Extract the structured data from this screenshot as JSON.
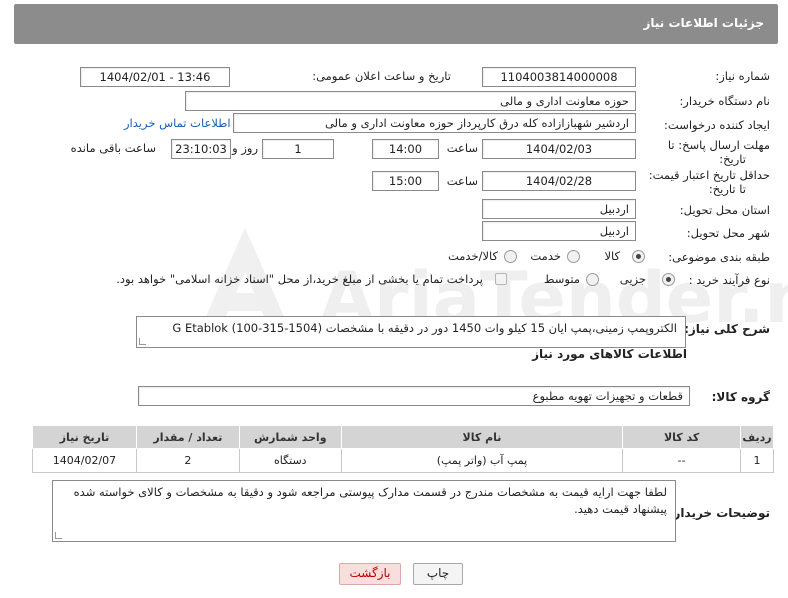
{
  "header": {
    "title": "جزئیات اطلاعات نیاز"
  },
  "fields": {
    "need_number_label": "شماره نیاز:",
    "need_number": "1104003814000008",
    "announce_label": "تاریخ و ساعت اعلان عمومی:",
    "announce_value": "1404/02/01 - 13:46",
    "buyer_label": "نام دستگاه خریدار:",
    "buyer_value": "حوزه معاونت اداری و مالی",
    "creator_label": "ایجاد کننده درخواست:",
    "creator_value": "اردشیر شهبازازاده کله درق کارپرداز حوزه معاونت اداری و مالی",
    "contact_link": "اطلاعات تماس خریدار",
    "deadline_label_1": "مهلت ارسال پاسخ: تا",
    "deadline_label_2": "تاریخ:",
    "deadline_date": "1404/02/03",
    "time_label": "ساعت",
    "deadline_time": "14:00",
    "days_value": "1",
    "days_label": "روز و",
    "remaining_value": "23:10:03",
    "remaining_label": "ساعت باقی مانده",
    "validity_label_1": "حداقل تاریخ اعتبار قیمت:",
    "validity_label_2": "تا تاریخ:",
    "validity_date": "1404/02/28",
    "validity_time_label": "ساعت",
    "validity_time": "15:00",
    "province_label": "استان محل تحویل:",
    "province_value": "اردبیل",
    "city_label": "شهر محل تحویل:",
    "city_value": "اردبیل",
    "category_label": "طبقه بندی موضوعی:",
    "category_options": [
      "کالا",
      "خدمت",
      "کالا/خدمت"
    ],
    "category_selected": "کالا",
    "process_label": "نوع فرآیند خرید :",
    "process_options": [
      "جزیی",
      "متوسط"
    ],
    "process_selected": "جزیی",
    "payment_note": "پرداخت تمام یا بخشی از مبلغ خرید،از محل \"اسناد خزانه اسلامی\" خواهد بود."
  },
  "description": {
    "label": "شرح کلی نیاز:",
    "value": "الکتروپمپ زمینی،پمپ ایان 15 کیلو وات 1450 دور در دقیقه با مشخصات (1504-315-100) G Etablok"
  },
  "goods_info_title": "اطلاعات کالاهای مورد نیاز",
  "goods_group": {
    "label": "گروه کالا:",
    "value": "قطعات و تجهیزات تهویه مطبوع"
  },
  "table": {
    "headers": [
      "ردیف",
      "کد کالا",
      "نام کالا",
      "واحد شمارش",
      "تعداد / مقدار",
      "تاریخ نیاز"
    ],
    "rows": [
      [
        "1",
        "--",
        "پمپ آب (واتر پمپ)",
        "دستگاه",
        "2",
        "1404/02/07"
      ]
    ]
  },
  "buyer_notes": {
    "label": "توضیحات خریدار:",
    "value": "لطفا جهت ارایه قیمت به مشخصات مندرج در قسمت مدارک پیوستی مراجعه شود و دقیقا به مشخصات و کالای خواسته شده پیشنهاد قیمت دهید."
  },
  "buttons": {
    "print": "چاپ",
    "back": "بازگشت"
  },
  "watermark": {
    "text": "AriaTender.neT"
  },
  "colors": {
    "header": "#8c8c8c",
    "link": "#1a5fb4",
    "back_button": "#f9dede",
    "table_header": "#d4d4d4"
  }
}
